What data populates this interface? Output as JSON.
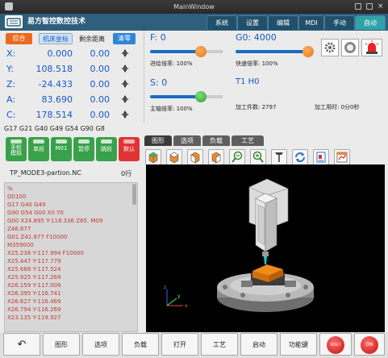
{
  "window": {
    "title": "MainWindow"
  },
  "header": {
    "app_name": "易方智控数控技术",
    "tabs": [
      {
        "label": "系统"
      },
      {
        "label": "设置"
      },
      {
        "label": "编辑"
      },
      {
        "label": "MDI"
      },
      {
        "label": "手动"
      },
      {
        "label": "自动"
      }
    ]
  },
  "coords": {
    "btn_combined": "综合",
    "btn_machine": "机床坐标",
    "col_remaining": "剩余距离",
    "btn_clear": "清零",
    "axes": [
      {
        "axis": "X:",
        "value": "0.000",
        "remaining": "0.00"
      },
      {
        "axis": "Y:",
        "value": "108.518",
        "remaining": "0.00"
      },
      {
        "axis": "Z:",
        "value": "-24.433",
        "remaining": "0.00"
      },
      {
        "axis": "A:",
        "value": "83.690",
        "remaining": "0.00"
      },
      {
        "axis": "C:",
        "value": "178.514",
        "remaining": "0.00"
      }
    ]
  },
  "feed": {
    "f_label": "F:",
    "f_value": "0",
    "feed_rate": "进给倍率: 100%",
    "g0_label": "G0:",
    "g0_value": "4000",
    "rapid_rate": "快速倍率: 100%",
    "s_label": "S:",
    "s_value": "0",
    "spindle_rate": "主轴倍率: 100%",
    "tool_label": "T1 H0",
    "parts_count": "加工件数: 2797",
    "time_count": "加工用时: 0分0秒",
    "feed_level": 0.7,
    "rapid_level": 0.95,
    "spindle_level": 0.7
  },
  "gcode_state": "G17 G21 G40 G49 G54 G90 G8",
  "mode_buttons": [
    {
      "label": "手轮\n模拟"
    },
    {
      "label": "单段"
    },
    {
      "label": "M01"
    },
    {
      "label": "暂停"
    },
    {
      "label": "跳段"
    },
    {
      "label": "默认"
    }
  ],
  "program": {
    "name": "TP_MODE3-partion.NC",
    "line_num": "0行",
    "lines": [
      "%",
      "O0100",
      "G17 G40 G49",
      "G90 G54 G00 X0 Y0",
      "G00 X24.895 Y-118.336 Z85. M09",
      "Z46.877",
      "G01 Z41.877 F10000",
      "M359000",
      "X25.238 Y-117.994 F10000",
      "X25.447 Y-117.779",
      "X25.688 Y-117.524",
      "X25.925 Y-117.269",
      "X26.159 Y-117.009",
      "X26.395 Y-116.741",
      "X26.627 Y-116.469",
      "X26.794 Y-116.269",
      "X23.135 Y-119.927"
    ]
  },
  "view_tabs": [
    {
      "label": "图形"
    },
    {
      "label": "选项"
    },
    {
      "label": "负载"
    },
    {
      "label": "工艺"
    }
  ],
  "view_tools": [
    "cube-front-icon",
    "cube-top-icon",
    "cube-side-icon",
    "cube-iso-icon",
    "zoom-out-icon",
    "zoom-in-icon",
    "tool-icon",
    "refresh-icon",
    "report-icon",
    "chart-icon"
  ],
  "bottom": {
    "back": "↶",
    "buttons": [
      {
        "label": "图形"
      },
      {
        "label": "选项"
      },
      {
        "label": "负载"
      },
      {
        "label": "打开"
      },
      {
        "label": "工艺"
      },
      {
        "label": "启动"
      },
      {
        "label": "功能键"
      }
    ],
    "reset": "RESET",
    "on": "ON"
  },
  "colors": {
    "accent": "#2f5f7c",
    "green": "#3aa14b",
    "blue_text": "#1659c4",
    "gcode_red": "#c43b2f"
  }
}
